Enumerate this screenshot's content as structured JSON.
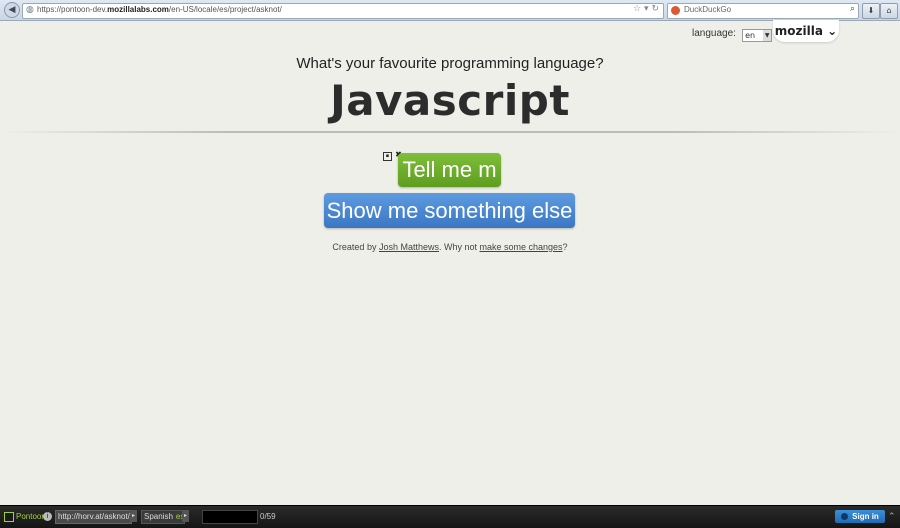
{
  "browser": {
    "url_prefix": "https://pontoon-dev.",
    "url_domain": "mozillalabs.com",
    "url_path": "/en-US/locale/es/project/asknot/",
    "search_engine": "DuckDuckGo"
  },
  "header": {
    "language_label": "language:",
    "language_value": "en",
    "brand": "mozilla"
  },
  "main": {
    "question": "What's your favourite programming language?",
    "answer": "Javascript",
    "primary_button": "Tell me m",
    "secondary_button": "Show me something else",
    "credit_prefix": "Created by ",
    "credit_author": "Josh Matthews",
    "credit_middle": ". Why not ",
    "credit_link": "make some changes",
    "credit_suffix": "?"
  },
  "pontoon": {
    "name": "Pontoon",
    "url": "http://horv.at/asknot/",
    "language": "Spanish",
    "language_code": "es",
    "progress_count": "0/59",
    "progress": 0,
    "sign_in": "Sign in"
  },
  "colors": {
    "primary_button": "#6aac2a",
    "secondary_button": "#4a86d2",
    "pontoon_accent": "#9fd13a",
    "sign_in": "#2f7fcb"
  },
  "icons": [
    "back-icon",
    "globe-icon",
    "star-icon",
    "reload-icon",
    "duckduckgo-icon",
    "search-icon",
    "download-icon",
    "home-icon",
    "save-icon",
    "close-icon",
    "chevron-down-icon",
    "info-icon",
    "user-icon"
  ]
}
